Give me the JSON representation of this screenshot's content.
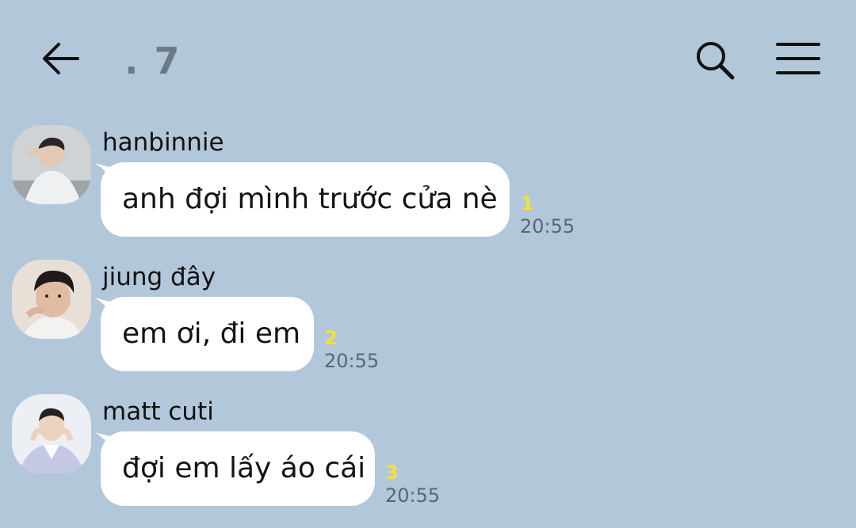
{
  "header": {
    "title": ". 7",
    "back_icon": "arrow-left-icon",
    "search_icon": "search-icon",
    "menu_icon": "hamburger-menu-icon"
  },
  "messages": [
    {
      "sender": "hanbinnie",
      "text": "anh đợi mình trước cửa nè",
      "unread": "1",
      "time": "20:55"
    },
    {
      "sender": "jiung đây",
      "text": "em ơi, đi em",
      "unread": "2",
      "time": "20:55"
    },
    {
      "sender": "matt cuti",
      "text": "đợi em lấy áo cái",
      "unread": "3",
      "time": "20:55"
    }
  ],
  "colors": {
    "background": "#b2c7da",
    "bubble": "#ffffff",
    "unread": "#f4e03b",
    "title": "#6d7a86"
  }
}
